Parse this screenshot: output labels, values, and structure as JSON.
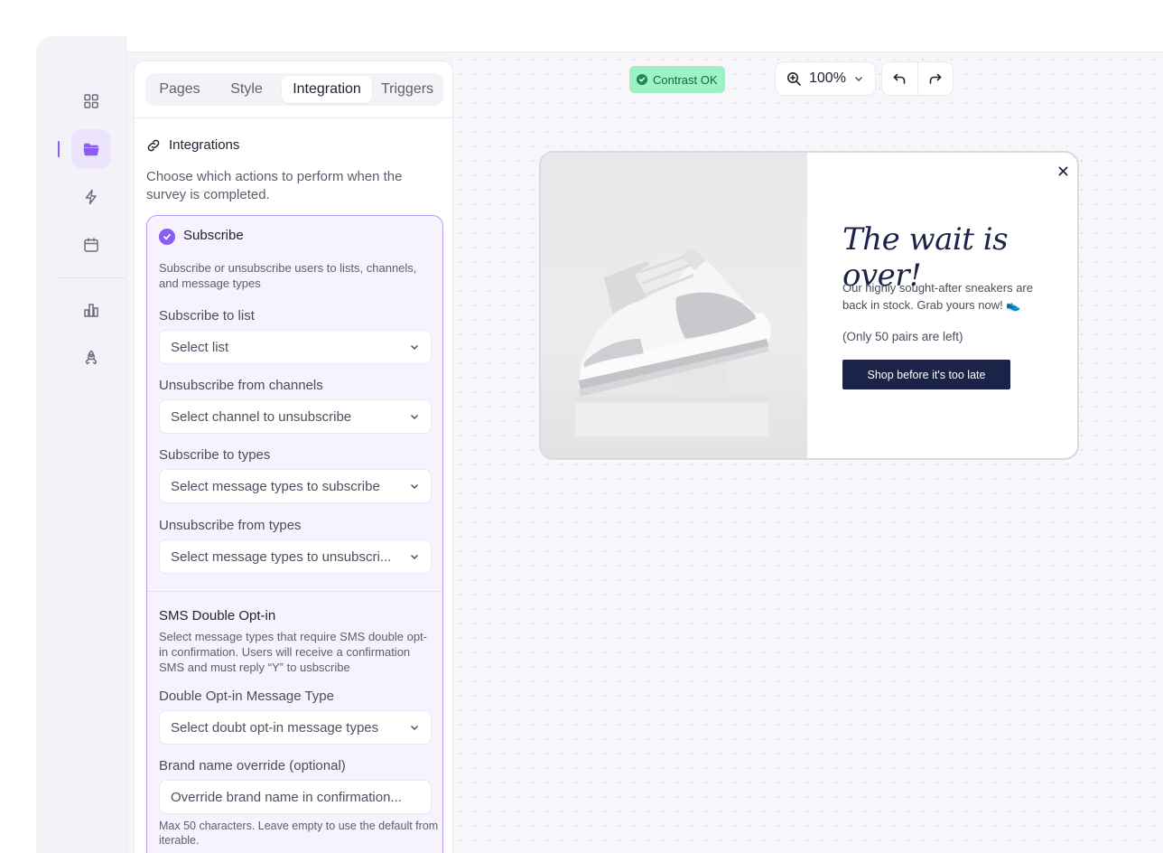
{
  "tabs": [
    "Pages",
    "Style",
    "Integration",
    "Triggers"
  ],
  "integrations": {
    "title": "Integrations",
    "description": "Choose which actions to perform when the survey is completed."
  },
  "subscribe": {
    "title": "Subscribe",
    "description": "Subscribe or unsubscribe users to lists, channels, and message types",
    "fields": [
      {
        "label": "Subscribe to list",
        "placeholder": "Select list"
      },
      {
        "label": "Unsubscribe from channels",
        "placeholder": "Select channel to unsubscribe"
      },
      {
        "label": "Subscribe to types",
        "placeholder": "Select message types to subscribe"
      },
      {
        "label": "Unsubscribe from types",
        "placeholder": "Select message types to unsubscri..."
      }
    ]
  },
  "sms": {
    "title": "SMS Double Opt-in",
    "description": "Select message types that require SMS double opt-in confirmation. Users will receive a confirmation SMS and must reply “Y” to usbscribe",
    "type_label": "Double Opt-in Message Type",
    "type_placeholder": "Select doubt opt-in message types",
    "brand_label": "Brand name override (optional)",
    "brand_placeholder": "Override brand name in confirmation...",
    "hint": "Max 50 characters. Leave empty to use the default from iterable."
  },
  "toolbar": {
    "contrast": "Contrast OK",
    "zoom": "100%"
  },
  "popup": {
    "headline": "The wait is over!",
    "body": "Our highly sought-after sneakers are back in stock. Grab yours now! 👟",
    "note": "(Only 50 pairs are left)",
    "cta": "Shop before it's too late"
  },
  "colors": {
    "accent": "#8b5cf6",
    "contrast_bg": "#9ef0c5",
    "popup_navy": "#1b2448"
  }
}
